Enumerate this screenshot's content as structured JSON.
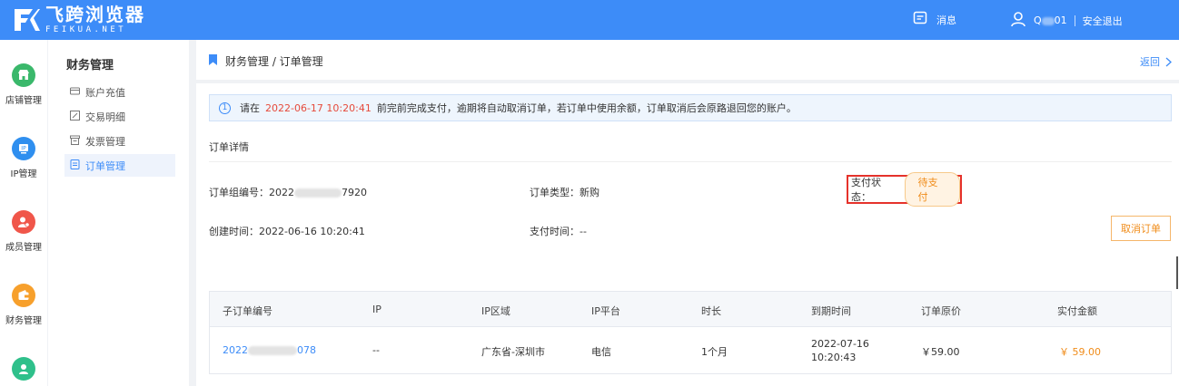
{
  "brand": {
    "name_cn": "飞跨浏览器",
    "name_en": "FEIKUA.NET",
    "color": "#3d8cf8"
  },
  "header": {
    "messages_label": "消息",
    "user_name_prefix": "Q",
    "user_name_suffix": "01",
    "logout_label": "安全退出"
  },
  "icon_nav": [
    {
      "label": "店铺管理",
      "icon": "shop-icon",
      "color": "#3ab86b"
    },
    {
      "label": "IP管理",
      "icon": "ip-icon",
      "color": "#2f8fef"
    },
    {
      "label": "成员管理",
      "icon": "member-icon",
      "color": "#f0564a"
    },
    {
      "label": "财务管理",
      "icon": "wallet-icon",
      "color": "#f7a02c"
    },
    {
      "label": "",
      "icon": "support-icon",
      "color": "#2fc08b"
    }
  ],
  "sub_menu": {
    "title": "财务管理",
    "items": [
      {
        "label": "账户充值",
        "icon": "card-icon",
        "active": false
      },
      {
        "label": "交易明细",
        "icon": "edit-icon",
        "active": false
      },
      {
        "label": "发票管理",
        "icon": "invoice-icon",
        "active": false
      },
      {
        "label": "订单管理",
        "icon": "order-icon",
        "active": true
      }
    ]
  },
  "breadcrumb": {
    "text": "财务管理 / 订单管理",
    "back_label": "返回"
  },
  "notice": {
    "prefix": "请在",
    "deadline": "2022-06-17 10:20:41",
    "suffix": "前完前完成支付，逾期将自动取消订单，若订单中使用余额，订单取消后会原路退回您的账户。"
  },
  "order": {
    "section_title": "订单详情",
    "group_no_label": "订单组编号：",
    "group_no_prefix": "2022",
    "group_no_suffix": "7920",
    "type_label": "订单类型：",
    "type_value": "新购",
    "status_label": "支付状态：",
    "status_value": "待支付",
    "created_label": "创建时间：",
    "created_value": "2022-06-16 10:20:41",
    "paid_label": "支付时间：",
    "paid_value": "--",
    "cancel_label": "取消订单"
  },
  "table": {
    "columns": [
      "子订单编号",
      "IP",
      "IP区域",
      "IP平台",
      "时长",
      "到期时间",
      "订单原价",
      "实付金额"
    ],
    "rows": [
      {
        "sub_no_prefix": "2022",
        "sub_no_suffix": "078",
        "ip": "--",
        "region": "广东省-深圳市",
        "platform": "电信",
        "duration": "1个月",
        "expire_date": "2022-07-16",
        "expire_time": "10:20:43",
        "original_price": "￥59.00",
        "paid_amount": "￥ 59.00"
      }
    ]
  }
}
